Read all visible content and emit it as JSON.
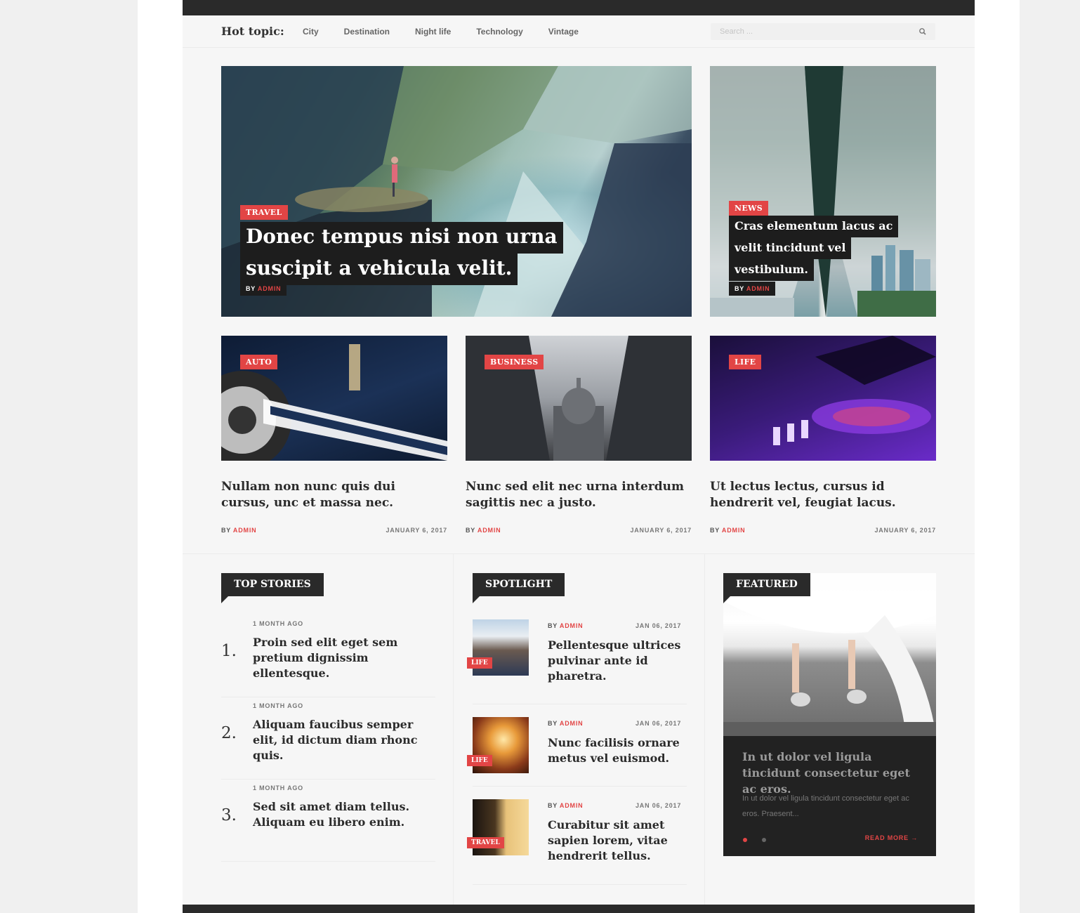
{
  "hot_topics": {
    "label": "Hot topic:",
    "links": [
      "City",
      "Destination",
      "Night life",
      "Technology",
      "Vintage"
    ]
  },
  "search": {
    "placeholder": "Search ..."
  },
  "hero": {
    "main": {
      "category": "TRAVEL",
      "title_lines": [
        "Donec tempus nisi non urna",
        "suscipit a vehicula velit."
      ],
      "by": "BY",
      "author": "ADMIN"
    },
    "side": {
      "category": "NEWS",
      "title_lines": [
        "Cras elementum lacus ac",
        "velit tincidunt vel",
        "vestibulum."
      ],
      "by": "BY",
      "author": "ADMIN"
    }
  },
  "cards": [
    {
      "category": "AUTO",
      "title": "Nullam non nunc quis dui cursus, unc et massa nec.",
      "by": "BY",
      "author": "ADMIN",
      "date": "JANUARY 6, 2017"
    },
    {
      "category": "BUSINESS",
      "title": "Nunc sed elit nec urna interdum sagittis nec a justo.",
      "by": "BY",
      "author": "ADMIN",
      "date": "JANUARY 6, 2017"
    },
    {
      "category": "LIFE",
      "title": "Ut lectus lectus, cursus id hendrerit vel, feugiat lacus.",
      "by": "BY",
      "author": "ADMIN",
      "date": "JANUARY 6, 2017"
    }
  ],
  "top_stories": {
    "heading": "TOP STORIES",
    "items": [
      {
        "num": "1.",
        "ago": "1 MONTH AGO",
        "title": "Proin sed elit eget sem pretium dignissim ellentesque."
      },
      {
        "num": "2.",
        "ago": "1 MONTH AGO",
        "title": "Aliquam faucibus semper elit, id dictum diam rhonc quis."
      },
      {
        "num": "3.",
        "ago": "1 MONTH AGO",
        "title": "Sed sit amet diam tellus. Aliquam eu libero enim."
      }
    ]
  },
  "spotlight": {
    "heading": "SPOTLIGHT",
    "items": [
      {
        "category": "LIFE",
        "by": "BY",
        "author": "ADMIN",
        "date": "JAN 06, 2017",
        "title": "Pellentesque ultrices pulvinar ante id pharetra."
      },
      {
        "category": "LIFE",
        "by": "BY",
        "author": "ADMIN",
        "date": "JAN 06, 2017",
        "title": "Nunc facilisis ornare metus vel euismod."
      },
      {
        "category": "TRAVEL",
        "by": "BY",
        "author": "ADMIN",
        "date": "JAN 06, 2017",
        "title": "Curabitur sit amet sapien lorem, vitae hendrerit tellus."
      }
    ]
  },
  "featured": {
    "heading": "FEATURED",
    "title": "In ut dolor vel ligula tincidunt consectetur eget ac eros.",
    "excerpt": "In ut dolor vel ligula tincidunt consectetur eget ac eros. Praesent...",
    "read_more": "READ MORE →"
  },
  "colors": {
    "accent": "#e24545",
    "dark": "#2a2a2a",
    "page_bg": "#f6f6f6"
  }
}
